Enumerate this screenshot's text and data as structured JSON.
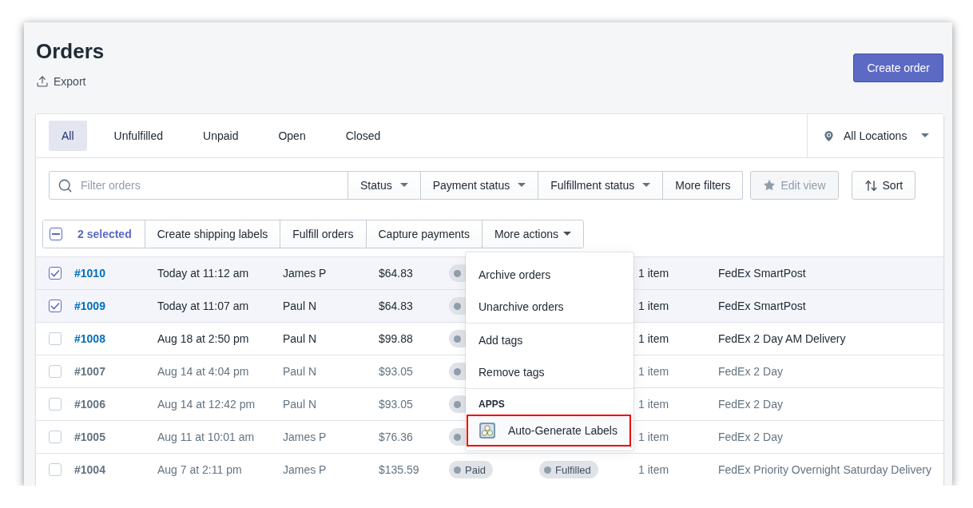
{
  "page": {
    "title": "Orders",
    "export": "Export",
    "primary_action": "Create order"
  },
  "tabs": [
    {
      "label": "All",
      "selected": true
    },
    {
      "label": "Unfulfilled",
      "selected": false
    },
    {
      "label": "Unpaid",
      "selected": false
    },
    {
      "label": "Open",
      "selected": false
    },
    {
      "label": "Closed",
      "selected": false
    }
  ],
  "location": "All Locations",
  "search": {
    "placeholder": "Filter orders"
  },
  "filters": [
    {
      "label": "Status",
      "kind": "dropdown"
    },
    {
      "label": "Payment status",
      "kind": "dropdown"
    },
    {
      "label": "Fulfillment status",
      "kind": "dropdown"
    },
    {
      "label": "More filters",
      "kind": "button"
    }
  ],
  "edit_view": {
    "label": "Edit view",
    "disabled": true
  },
  "sort": "Sort",
  "bulk": {
    "partial": true,
    "count": "2 selected",
    "actions": [
      {
        "label": "Create shipping labels",
        "kind": "button"
      },
      {
        "label": "Fulfill orders",
        "kind": "button"
      },
      {
        "label": "Capture payments",
        "kind": "button"
      },
      {
        "label": "More actions",
        "kind": "dropdown"
      }
    ]
  },
  "rows": [
    {
      "order": "#1010",
      "date": "Today at 11:12 am",
      "customer": "James P",
      "total": "$64.83",
      "items": "1 item",
      "delivery": "FedEx SmartPost",
      "selected": true,
      "muted": false
    },
    {
      "order": "#1009",
      "date": "Today at 11:07 am",
      "customer": "Paul N",
      "total": "$64.83",
      "items": "1 item",
      "delivery": "FedEx SmartPost",
      "selected": true,
      "muted": false
    },
    {
      "order": "#1008",
      "date": "Aug 18 at 2:50 pm",
      "customer": "Paul N",
      "total": "$99.88",
      "items": "1 item",
      "delivery": "FedEx 2 Day AM Delivery",
      "selected": false,
      "muted": false
    },
    {
      "order": "#1007",
      "date": "Aug 14 at 4:04 pm",
      "customer": "Paul N",
      "total": "$93.05",
      "items": "1 item",
      "delivery": "FedEx 2 Day",
      "selected": false,
      "muted": true
    },
    {
      "order": "#1006",
      "date": "Aug 14 at 12:42 pm",
      "customer": "Paul N",
      "total": "$93.05",
      "items": "1 item",
      "delivery": "FedEx 2 Day",
      "selected": false,
      "muted": true
    },
    {
      "order": "#1005",
      "date": "Aug 11 at 10:01 am",
      "customer": "James P",
      "total": "$76.36",
      "items": "1 item",
      "delivery": "FedEx 2 Day",
      "selected": false,
      "muted": true
    },
    {
      "order": "#1004",
      "date": "Aug 7 at 2:11 pm",
      "customer": "James P",
      "total": "$135.59",
      "payment": "Paid",
      "fulfillment": "Fulfilled",
      "items": "1 item",
      "delivery": "FedEx Priority Overnight Saturday Delivery",
      "selected": false,
      "muted": true
    }
  ],
  "menu": {
    "sections": [
      {
        "items": [
          {
            "label": "Archive orders",
            "kind": "plain",
            "highlighted": false
          },
          {
            "label": "Unarchive orders",
            "kind": "plain",
            "highlighted": false
          }
        ]
      },
      {
        "items": [
          {
            "label": "Add tags",
            "kind": "plain",
            "highlighted": false
          },
          {
            "label": "Remove tags",
            "kind": "plain",
            "highlighted": false
          }
        ]
      },
      {
        "title": "APPS",
        "items": [
          {
            "label": "Auto-Generate Labels",
            "kind": "app",
            "highlighted": true
          }
        ]
      }
    ]
  }
}
